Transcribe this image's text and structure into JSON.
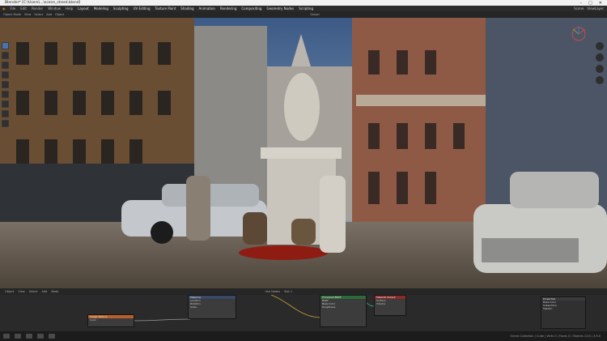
{
  "window": {
    "title": "Blender* [C:\\Users\\...\\scene_street.blend]"
  },
  "menu": {
    "items": [
      "File",
      "Edit",
      "Render",
      "Window",
      "Help"
    ],
    "workspaces": [
      "Layout",
      "Modeling",
      "Sculpting",
      "UV Editing",
      "Texture Paint",
      "Shading",
      "Animation",
      "Rendering",
      "Compositing",
      "Geometry Nodes",
      "Scripting"
    ],
    "scene": "Scene",
    "view_layer": "ViewLayer"
  },
  "viewport_header": {
    "mode": "Object Mode",
    "items": [
      "View",
      "Select",
      "Add",
      "Object"
    ],
    "transform": "Global"
  },
  "node_header": {
    "items": [
      "Object",
      "View",
      "Select",
      "Add",
      "Node"
    ],
    "use_nodes": "Use Nodes",
    "slot": "Slot 1"
  },
  "nodes": [
    {
      "title": "Image Texture",
      "rows": [
        "Color",
        "Alpha"
      ]
    },
    {
      "title": "Mapping",
      "rows": [
        "Vector",
        "Location",
        "Rotation",
        "Scale"
      ]
    },
    {
      "title": "Principled BSDF",
      "rows": [
        "BSDF",
        "Base Color",
        "Roughness"
      ]
    },
    {
      "title": "Material Output",
      "rows": [
        "All",
        "Surface",
        "Volume",
        "Displacement"
      ]
    },
    {
      "title": "Properties",
      "rows": [
        "Base Color",
        "Subsurface",
        "Metallic"
      ]
    }
  ],
  "status": {
    "text": "Scene Collection | Cube | Verts 0 | Faces 0 | Objects 1/14 | 3.6.0"
  },
  "colors": {
    "accent": "#4772b3",
    "node_header_orange": "#b5602b",
    "node_header_green": "#2f6b3a"
  }
}
